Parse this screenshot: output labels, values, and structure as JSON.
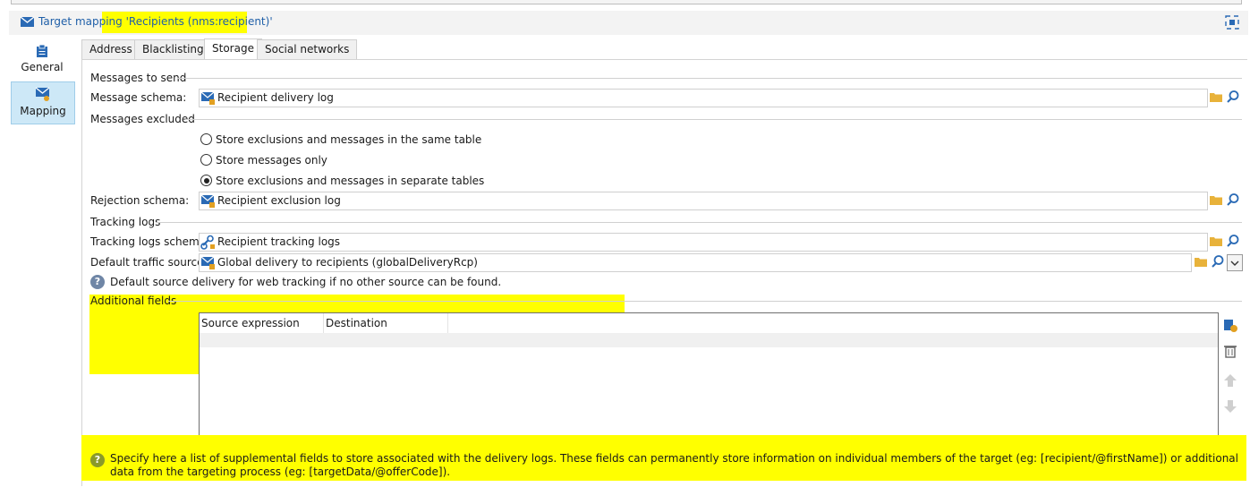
{
  "header": {
    "title_prefix": "Target mapping",
    "title_highlight": "'Recipients (nms:recipient)'"
  },
  "sidebar": {
    "items": [
      {
        "label": "General",
        "icon": "clipboard-icon"
      },
      {
        "label": "Mapping",
        "icon": "mapping-envelope-icon",
        "selected": true
      }
    ]
  },
  "tabs": [
    {
      "label": "Address"
    },
    {
      "label": "Blacklisting"
    },
    {
      "label": "Storage",
      "active": true
    },
    {
      "label": "Social networks"
    }
  ],
  "storage": {
    "messages_to_send": "Messages to send",
    "message_schema_label": "Message schema:",
    "message_schema_value": "Recipient delivery log",
    "messages_excluded": "Messages excluded",
    "radio_options": [
      {
        "label": "Store exclusions and messages in the same table",
        "checked": false
      },
      {
        "label": "Store messages only",
        "checked": false
      },
      {
        "label": "Store exclusions and messages in separate tables",
        "checked": true
      }
    ],
    "rejection_schema_label": "Rejection schema:",
    "rejection_schema_value": "Recipient exclusion log",
    "tracking_logs": "Tracking logs",
    "tracking_schema_label": "Tracking logs schema:",
    "tracking_schema_value": "Recipient tracking logs",
    "traffic_source_label": "Default traffic source:",
    "traffic_source_value": "Global delivery to recipients (globalDeliveryRcp)",
    "traffic_help": "Default source delivery for web tracking if no other source can be found.",
    "additional_fields": "Additional fields",
    "grid_columns": [
      "Source expression",
      "Destination"
    ],
    "bottom_help": "Specify here a list of supplemental fields to store associated with the delivery logs. These fields can permanently store information on individual members of the target (eg: [recipient/@firstName]) or additional data from the targeting process (eg: [targetData/@offerCode])."
  },
  "colors": {
    "highlight": "#ffff00",
    "title_blue": "#1f5fa8",
    "selected_bg": "#cde8f7"
  }
}
